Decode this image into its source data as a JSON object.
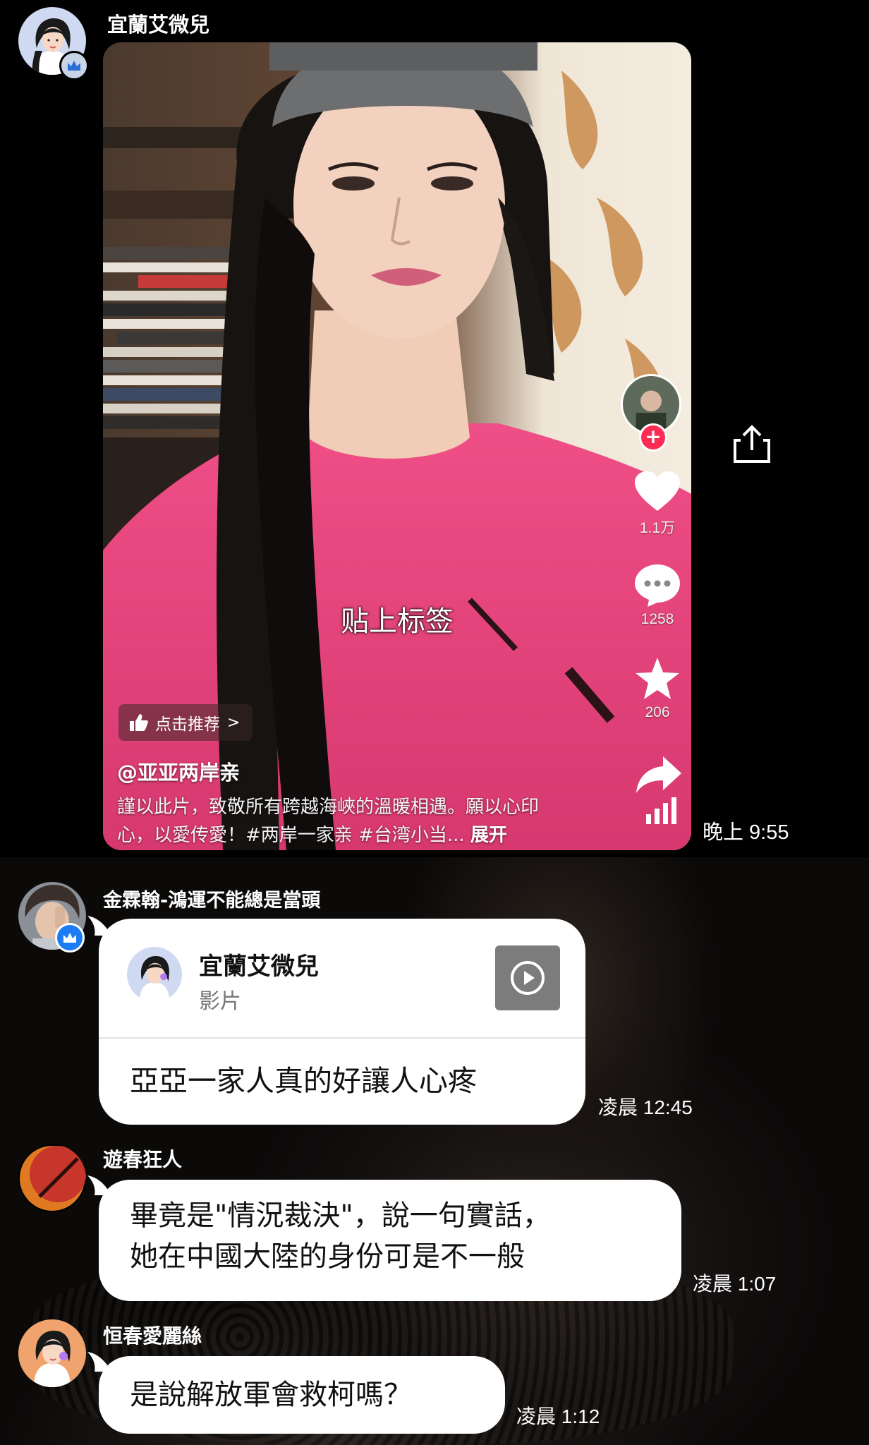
{
  "messages": [
    {
      "sender": "宜蘭艾微兒",
      "avatar": "woman-avatar",
      "badge": "crown",
      "time": "晚上 9:55",
      "video": {
        "subtitle": "贴上标签",
        "recommend_label": "点击推荐",
        "author": "@亚亚两岸亲",
        "caption": "謹以此片，致敬所有跨越海峽的溫暖相遇。願以心印心，以愛传愛！#两岸一家亲 #台湾小当...",
        "expand_label": "展开",
        "likes": "1.1万",
        "comments": "1258",
        "favorites": "206"
      }
    },
    {
      "sender": "金霖翰-鴻運不能總是當頭",
      "avatar": "man-photo-avatar",
      "badge": "crown-blue",
      "time": "凌晨 12:45",
      "share_card": {
        "title": "宜蘭艾微兒",
        "subtitle": "影片"
      },
      "text": "亞亞一家人真的好讓人心疼"
    },
    {
      "sender": "遊春狂人",
      "avatar": "red-moon-avatar",
      "time": "凌晨 1:07",
      "lines": [
        "畢竟是\"情況裁決\"，說一句實話，",
        "她在中國大陸的身份可是不一般"
      ]
    },
    {
      "sender": "恒春愛麗絲",
      "avatar": "woman-avatar-orange",
      "time": "凌晨 1:12",
      "text": "是說解放軍會救柯嗎？"
    }
  ],
  "colors": {
    "background": "#000000",
    "bubble": "#ffffff",
    "shirt": "#e8407a",
    "tiktok_red": "#fe2c55",
    "crown_badge": "#c9d3e6",
    "verified_blue": "#1c7cf4"
  },
  "icons": [
    "share-icon",
    "heart-icon",
    "comment-icon",
    "star-icon",
    "forward-icon",
    "play-icon",
    "thumbs-up-icon",
    "chevron-right-icon",
    "crown-icon",
    "plus-icon"
  ]
}
